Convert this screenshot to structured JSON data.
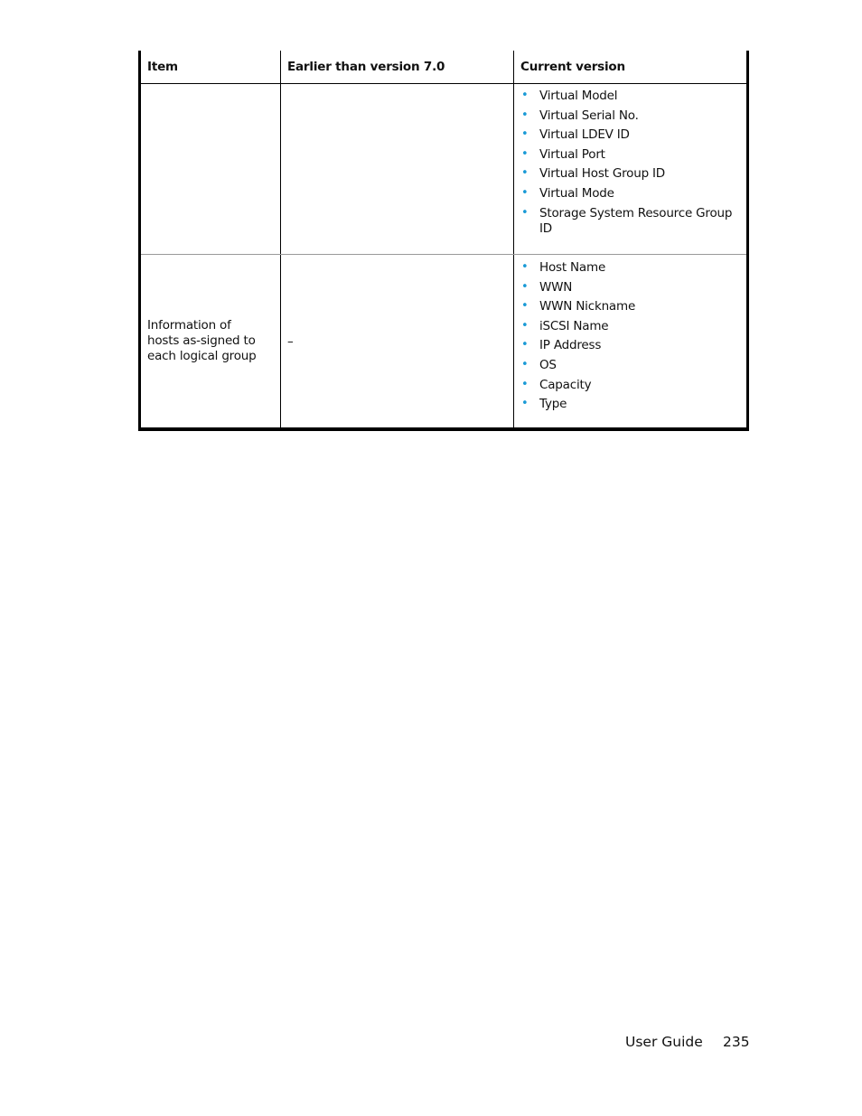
{
  "table": {
    "headers": [
      "Item",
      "Earlier than version 7.0",
      "Current version"
    ],
    "rows": [
      {
        "item": "",
        "earlier": "",
        "current": [
          "Virtual Model",
          "Virtual Serial No.",
          "Virtual LDEV ID",
          "Virtual Port",
          "Virtual Host Group ID",
          "Virtual Mode",
          "Storage System Resource Group ID"
        ]
      },
      {
        "item": "Information of hosts as-signed to each logical group",
        "earlier": "–",
        "current": [
          "Host Name",
          "WWN",
          "WWN Nickname",
          "iSCSI Name",
          "IP Address",
          "OS",
          "Capacity",
          "Type"
        ]
      }
    ]
  },
  "footer": {
    "label": "User Guide",
    "page_number": "235"
  },
  "colors": {
    "bullet": "#1a9ad6"
  }
}
